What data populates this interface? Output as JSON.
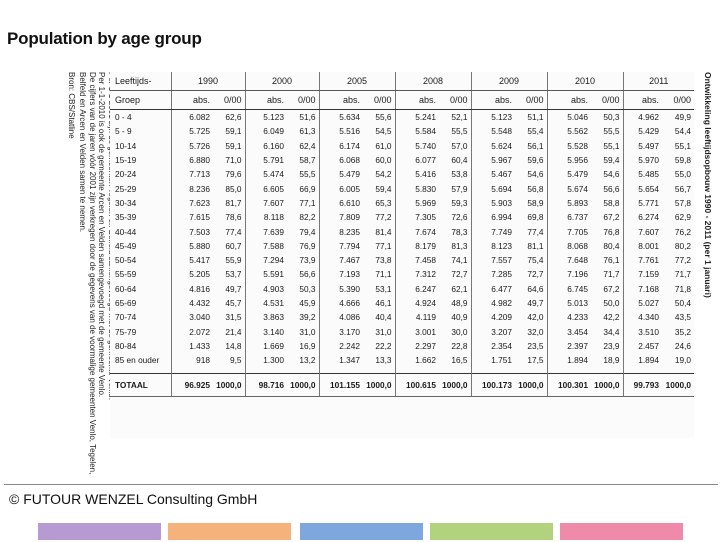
{
  "slide": {
    "title": "Population by age group",
    "footer": "© FUTOUR WENZEL Consulting GmbH",
    "bar_colors": [
      "#b79ad2",
      "#f5b27a",
      "#7ea7dd",
      "#b3d27d",
      "#f08aaa"
    ]
  },
  "notes": [
    "Per 1-1-2001 zijn de gemeenten Tegelen en Belfeld samengevoegd met de gemeente Venlo.",
    "Per 1-1-2010 is ook de gemeente Arcen en Velden samengevoegd met de gemeente Venlo.",
    "De cijfers van de jaren vóór 2001 zijn verkregen door de gegevens van de voormalige gemeenten Venlo, Tegelen,",
    "Belfeld en Arcen en Velden samen te nemen.",
    "Bron: CBS/Statline"
  ],
  "table": {
    "caption": "Ontwikkeling leeftijdsopbouw 1990 - 2011 (per 1 januari)",
    "group_header_line1": "Leeftijds-",
    "group_header_line2": "Groep",
    "years": [
      "1990",
      "2000",
      "2005",
      "2008",
      "2009",
      "2010",
      "2011"
    ],
    "sub_abs": "abs.",
    "sub_rel": "0/00",
    "rows": [
      {
        "g": "0 - 4",
        "v": [
          "6.082",
          "62,6",
          "5.123",
          "51,6",
          "5.634",
          "55,6",
          "5.241",
          "52,1",
          "5.123",
          "51,1",
          "5.046",
          "50,3",
          "4.962",
          "49,9"
        ]
      },
      {
        "g": "5 - 9",
        "v": [
          "5.725",
          "59,1",
          "6.049",
          "61,3",
          "5.516",
          "54,5",
          "5.584",
          "55,5",
          "5.548",
          "55,4",
          "5.562",
          "55,5",
          "5.429",
          "54,4"
        ]
      },
      {
        "g": "10-14",
        "v": [
          "5.726",
          "59,1",
          "6.160",
          "62,4",
          "6.174",
          "61,0",
          "5.740",
          "57,0",
          "5.624",
          "56,1",
          "5.528",
          "55,1",
          "5.497",
          "55,1"
        ]
      },
      {
        "g": "15-19",
        "v": [
          "6.880",
          "71,0",
          "5.791",
          "58,7",
          "6.068",
          "60,0",
          "6.077",
          "60,4",
          "5.967",
          "59,6",
          "5.956",
          "59,4",
          "5.970",
          "59,8"
        ]
      },
      {
        "g": "20-24",
        "v": [
          "7.713",
          "79,6",
          "5.474",
          "55,5",
          "5.479",
          "54,2",
          "5.416",
          "53,8",
          "5.467",
          "54,6",
          "5.479",
          "54,6",
          "5.485",
          "55,0"
        ]
      },
      {
        "g": "25-29",
        "v": [
          "8.236",
          "85,0",
          "6.605",
          "66,9",
          "6.005",
          "59,4",
          "5.830",
          "57,9",
          "5.694",
          "56,8",
          "5.674",
          "56,6",
          "5.654",
          "56,7"
        ]
      },
      {
        "g": "30-34",
        "v": [
          "7.623",
          "81,7",
          "7.607",
          "77,1",
          "6.610",
          "65,3",
          "5.969",
          "59,3",
          "5.903",
          "58,9",
          "5.893",
          "58,8",
          "5.771",
          "57,8"
        ]
      },
      {
        "g": "35-39",
        "v": [
          "7.615",
          "78,6",
          "8.118",
          "82,2",
          "7.809",
          "77,2",
          "7.305",
          "72,6",
          "6.994",
          "69,8",
          "6.737",
          "67,2",
          "6.274",
          "62,9"
        ]
      },
      {
        "g": "40-44",
        "v": [
          "7.503",
          "77,4",
          "7.639",
          "79,4",
          "8.235",
          "81,4",
          "7.674",
          "78,3",
          "7.749",
          "77,4",
          "7.705",
          "76,8",
          "7.607",
          "76,2"
        ]
      },
      {
        "g": "45-49",
        "v": [
          "5.880",
          "60,7",
          "7.588",
          "76,9",
          "7.794",
          "77,1",
          "8.179",
          "81,3",
          "8.123",
          "81,1",
          "8.068",
          "80,4",
          "8.001",
          "80,2"
        ]
      },
      {
        "g": "50-54",
        "v": [
          "5.417",
          "55,9",
          "7.294",
          "73,9",
          "7.467",
          "73,8",
          "7.458",
          "74,1",
          "7.557",
          "75,4",
          "7.648",
          "76,1",
          "7.761",
          "77,2"
        ]
      },
      {
        "g": "55-59",
        "v": [
          "5.205",
          "53,7",
          "5.591",
          "56,6",
          "7.193",
          "71,1",
          "7.312",
          "72,7",
          "7.285",
          "72,7",
          "7.196",
          "71,7",
          "7.159",
          "71,7"
        ]
      },
      {
        "g": "60-64",
        "v": [
          "4.816",
          "49,7",
          "4.903",
          "50,3",
          "5.390",
          "53,1",
          "6.247",
          "62,1",
          "6.477",
          "64,6",
          "6.745",
          "67,2",
          "7.168",
          "71,8"
        ]
      },
      {
        "g": "65-69",
        "v": [
          "4.432",
          "45,7",
          "4.531",
          "45,9",
          "4.666",
          "46,1",
          "4.924",
          "48,9",
          "4.982",
          "49,7",
          "5.013",
          "50,0",
          "5.027",
          "50,4"
        ]
      },
      {
        "g": "70-74",
        "v": [
          "3.040",
          "31,5",
          "3.863",
          "39,2",
          "4.086",
          "40,4",
          "4.119",
          "40,9",
          "4.209",
          "42,0",
          "4.233",
          "42,2",
          "4.340",
          "43,5"
        ]
      },
      {
        "g": "75-79",
        "v": [
          "2.072",
          "21,4",
          "3.140",
          "31,0",
          "3.170",
          "31,0",
          "3.001",
          "30,0",
          "3.207",
          "32,0",
          "3.454",
          "34,4",
          "3.510",
          "35,2"
        ]
      },
      {
        "g": "80-84",
        "v": [
          "1.433",
          "14,8",
          "1.669",
          "16,9",
          "2.242",
          "22,2",
          "2.297",
          "22,8",
          "2.354",
          "23,5",
          "2.397",
          "23,9",
          "2.457",
          "24,6"
        ]
      },
      {
        "g": "85 en ouder",
        "v": [
          "918",
          "9,5",
          "1.300",
          "13,2",
          "1.347",
          "13,3",
          "1.662",
          "16,5",
          "1.751",
          "17,5",
          "1.894",
          "18,9",
          "1.894",
          "19,0"
        ]
      }
    ],
    "total": {
      "g": "TOTAAL",
      "v": [
        "96.925",
        "1000,0",
        "98.716",
        "1000,0",
        "101.155",
        "1000,0",
        "100.615",
        "1000,0",
        "100.173",
        "1000,0",
        "100.301",
        "1000,0",
        "99.793",
        "1000,0"
      ]
    }
  }
}
